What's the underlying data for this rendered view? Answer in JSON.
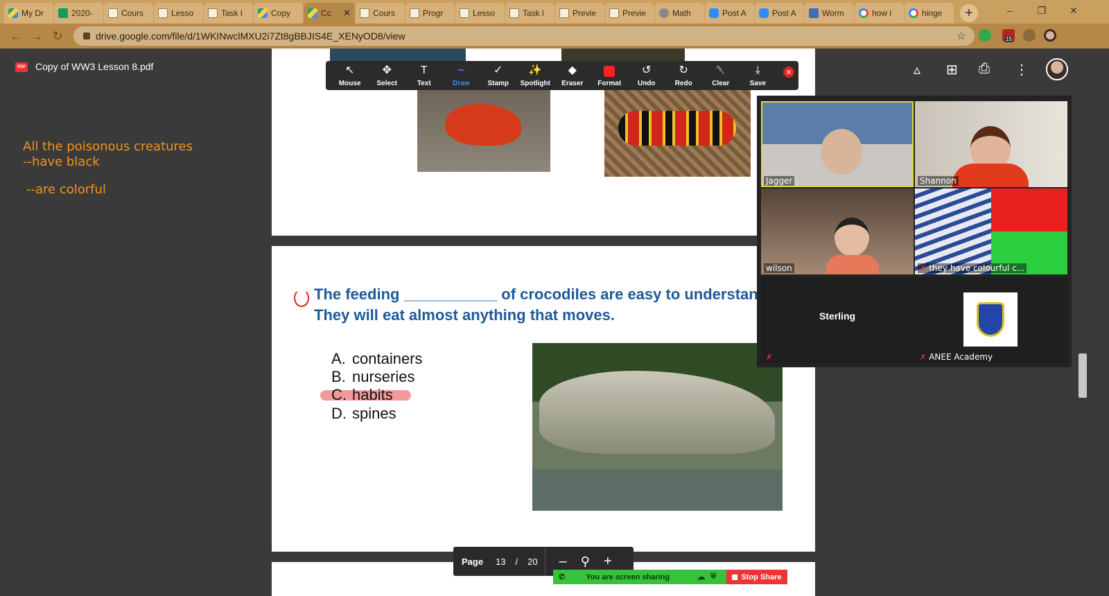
{
  "browser": {
    "tabs": [
      {
        "label": "My Dr",
        "icon": "drive"
      },
      {
        "label": "2020-",
        "icon": "sheets"
      },
      {
        "label": "Cours",
        "icon": "doc"
      },
      {
        "label": "Lesso",
        "icon": "doc"
      },
      {
        "label": "Task l",
        "icon": "doc"
      },
      {
        "label": "Copy",
        "icon": "drive"
      },
      {
        "label": "Cc",
        "icon": "drive",
        "active": true
      },
      {
        "label": "Cours",
        "icon": "doc"
      },
      {
        "label": "Progr",
        "icon": "doc"
      },
      {
        "label": "Lesso",
        "icon": "doc"
      },
      {
        "label": "Task l",
        "icon": "doc"
      },
      {
        "label": "Previe",
        "icon": "doc"
      },
      {
        "label": "Previe",
        "icon": "doc"
      },
      {
        "label": "Math",
        "icon": "globe"
      },
      {
        "label": "Post A",
        "icon": "zoom"
      },
      {
        "label": "Post A",
        "icon": "zoom"
      },
      {
        "label": "Worm",
        "icon": "worm"
      },
      {
        "label": "how l",
        "icon": "google"
      },
      {
        "label": "hinge",
        "icon": "google"
      }
    ],
    "url": "drive.google.com/file/d/1WKINwclMXU2i7Zt8gBBJIS4E_XENyOD8/view",
    "ext_badge": "15"
  },
  "viewer": {
    "file_title": "Copy of WW3 Lesson 8.pdf",
    "pdf_badge": "PDF"
  },
  "annotations": {
    "line1": "All the poisonous creatures",
    "line2": "--have black",
    "line3": "--are colorful"
  },
  "question": {
    "line1": "The feeding ___________ of crocodiles are easy to understand.",
    "line2": "They will eat almost anything that moves.",
    "options": [
      {
        "letter": "A.",
        "text": "containers"
      },
      {
        "letter": "B.",
        "text": "nurseries"
      },
      {
        "letter": "C.",
        "text": "habits"
      },
      {
        "letter": "D.",
        "text": "spines"
      }
    ]
  },
  "annotate_toolbar": {
    "tools": [
      {
        "label": "Mouse",
        "icon": "cursor-icon"
      },
      {
        "label": "Select",
        "icon": "move-icon"
      },
      {
        "label": "Text",
        "icon": "text-icon"
      },
      {
        "label": "Draw",
        "icon": "draw-icon",
        "active": true
      },
      {
        "label": "Stamp",
        "icon": "check-icon"
      },
      {
        "label": "Spotlight",
        "icon": "wand-icon"
      },
      {
        "label": "Eraser",
        "icon": "eraser-icon"
      },
      {
        "label": "Format",
        "icon": "format-icon",
        "color": "#ff2222"
      },
      {
        "label": "Undo",
        "icon": "undo-icon"
      },
      {
        "label": "Redo",
        "icon": "redo-icon"
      },
      {
        "label": "Clear",
        "icon": "trash-icon"
      },
      {
        "label": "Save",
        "icon": "save-icon"
      }
    ]
  },
  "participants": [
    {
      "name": "Jagger",
      "speaking": true,
      "muted": false
    },
    {
      "name": "Shannon",
      "muted": false
    },
    {
      "name": "wilson",
      "muted": false
    },
    {
      "name": "they have colourful c...",
      "muted": true
    },
    {
      "name": "Sterling",
      "muted": true,
      "video": false
    },
    {
      "name": "ANEE Academy",
      "muted": true,
      "logo": true
    }
  ],
  "page_controls": {
    "label": "Page",
    "current": "13",
    "separator": "/",
    "total": "20",
    "zoom_out": "–",
    "zoom_in": "+"
  },
  "share_bar": {
    "status": "You are screen sharing",
    "stop_label": "Stop Share"
  },
  "colors": {
    "annotation": "#f2951a",
    "question": "#1e5a9a",
    "highlight": "#f29a9a",
    "share_green": "#36c23a",
    "stop_red": "#e33333"
  }
}
